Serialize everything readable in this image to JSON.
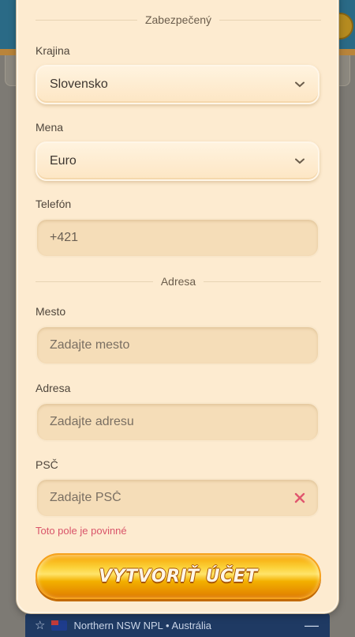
{
  "background": {
    "league_bar": {
      "name": "Northern NSW NPL • Austrália"
    }
  },
  "form": {
    "section_secure": "Zabezpečený",
    "country": {
      "label": "Krajina",
      "value": "Slovensko"
    },
    "currency": {
      "label": "Mena",
      "value": "Euro"
    },
    "phone": {
      "label": "Telefón",
      "value": "+421"
    },
    "section_address": "Adresa",
    "city": {
      "label": "Mesto",
      "placeholder": "Zadajte mesto"
    },
    "address": {
      "label": "Adresa",
      "placeholder": "Zadajte adresu"
    },
    "postal": {
      "label": "PSČ",
      "placeholder": "Zadajte PSČ",
      "error": "Toto pole je povinné"
    },
    "submit_label": "VYTVORIŤ ÚČET"
  },
  "colors": {
    "modal_bg": "#fdebd0",
    "error": "#d9546a",
    "button": "#f7a100"
  }
}
